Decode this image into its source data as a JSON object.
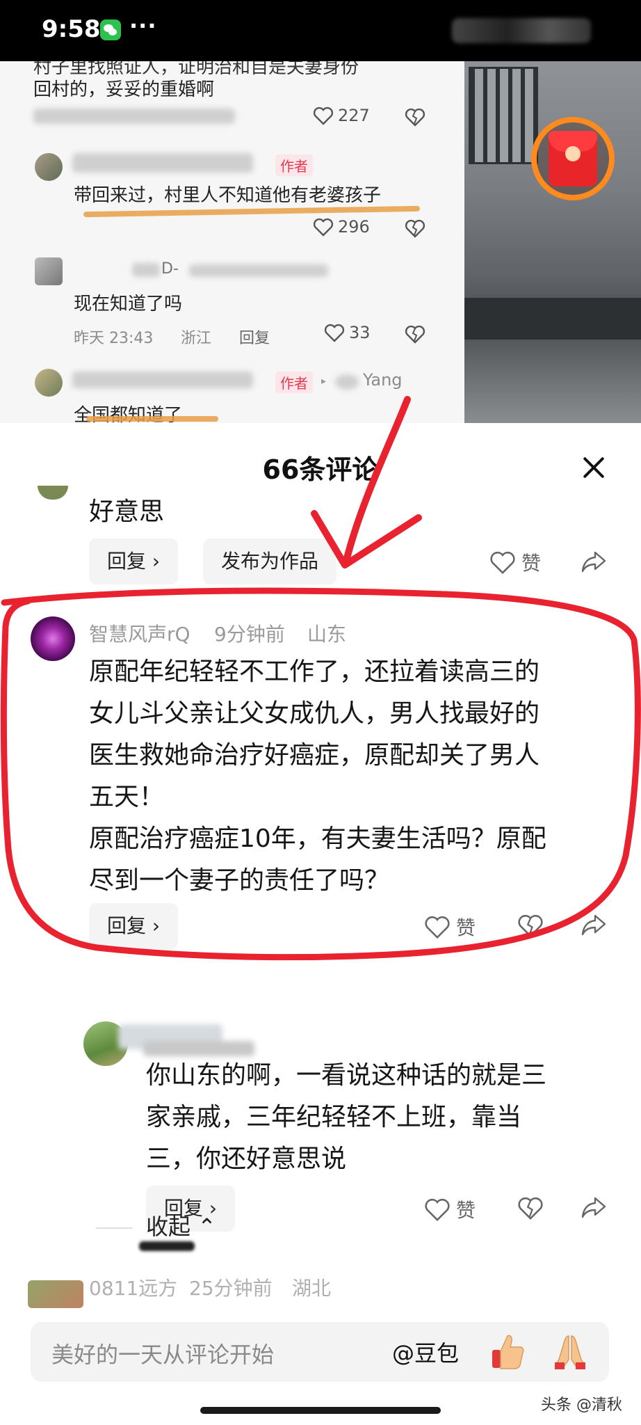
{
  "status_bar": {
    "time": "9:58",
    "more": "···"
  },
  "background": {
    "c1_text_line1": "村子里找照证人，证明治和自是夫妻身份",
    "c1_text_line2": "回村的，妥妥的重婚啊",
    "c1_likes": "227",
    "author_tag": "作者",
    "c2_text": "带回来过，村里人不知道他有老婆孩子",
    "c2_likes": "296",
    "c3_name_partial": "D-",
    "c3_text": "现在知道了吗",
    "c3_time": "昨天 23:43",
    "c3_location": "浙江",
    "c3_reply": "回复",
    "c3_likes": "33",
    "c4_reply_to": "Yang",
    "c4_text": "全国都知道了"
  },
  "sheet": {
    "title": "66条评论",
    "prev_comment_tail": "好意思",
    "prev_reply_btn": "回复 ›",
    "prev_publish_btn": "发布为作品",
    "prev_like_label": "赞",
    "main_comment": {
      "username": "智慧风声rQ",
      "time": "9分钟前",
      "location": "山东",
      "lines": [
        "原配年纪轻轻不工作了，还拉着读高三的",
        "女儿斗父亲让父女成仇人，男人找最好的",
        "医生救她命治疗好癌症，原配却关了男人",
        "五天！",
        "原配治疗癌症10年，有夫妻生活吗？原配",
        "尽到一个妻子的责任了吗？"
      ],
      "reply_btn": "回复 ›",
      "like_label": "赞"
    },
    "reply_comment": {
      "lines": [
        "你山东的啊，一看说这种话的就是三",
        "家亲戚，三年纪轻轻不上班，靠当",
        "三，你还好意思说"
      ],
      "reply_btn": "回复 ›",
      "like_label": "赞"
    },
    "collapse_label": "收起 ⌃",
    "next_comment": {
      "username": "0811远方",
      "time": "25分钟前",
      "location": "湖北"
    }
  },
  "input_bar": {
    "placeholder": "美好的一天从评论开始",
    "mention": "@豆包"
  },
  "watermark": "头条 @清秋",
  "colors": {
    "author_tag": "#e03a52",
    "annotation_red": "#e8232f",
    "highlight_orange": "#e89f45",
    "redpacket_ring": "#ff8a1e"
  }
}
